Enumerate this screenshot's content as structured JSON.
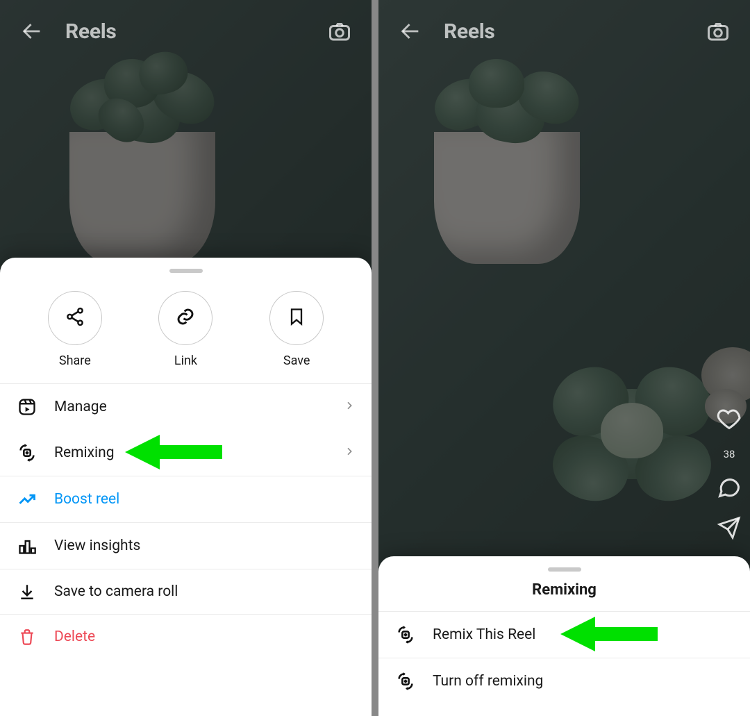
{
  "left": {
    "header_title": "Reels",
    "actions": [
      {
        "label": "Share"
      },
      {
        "label": "Link"
      },
      {
        "label": "Save"
      }
    ],
    "rows": {
      "manage": "Manage",
      "remixing": "Remixing",
      "boost": "Boost reel",
      "insights": "View insights",
      "save_roll": "Save to camera roll",
      "delete": "Delete"
    }
  },
  "right": {
    "header_title": "Reels",
    "like_count": "38",
    "sheet_title": "Remixing",
    "rows": {
      "remix_this": "Remix This Reel",
      "turn_off": "Turn off remixing"
    }
  }
}
